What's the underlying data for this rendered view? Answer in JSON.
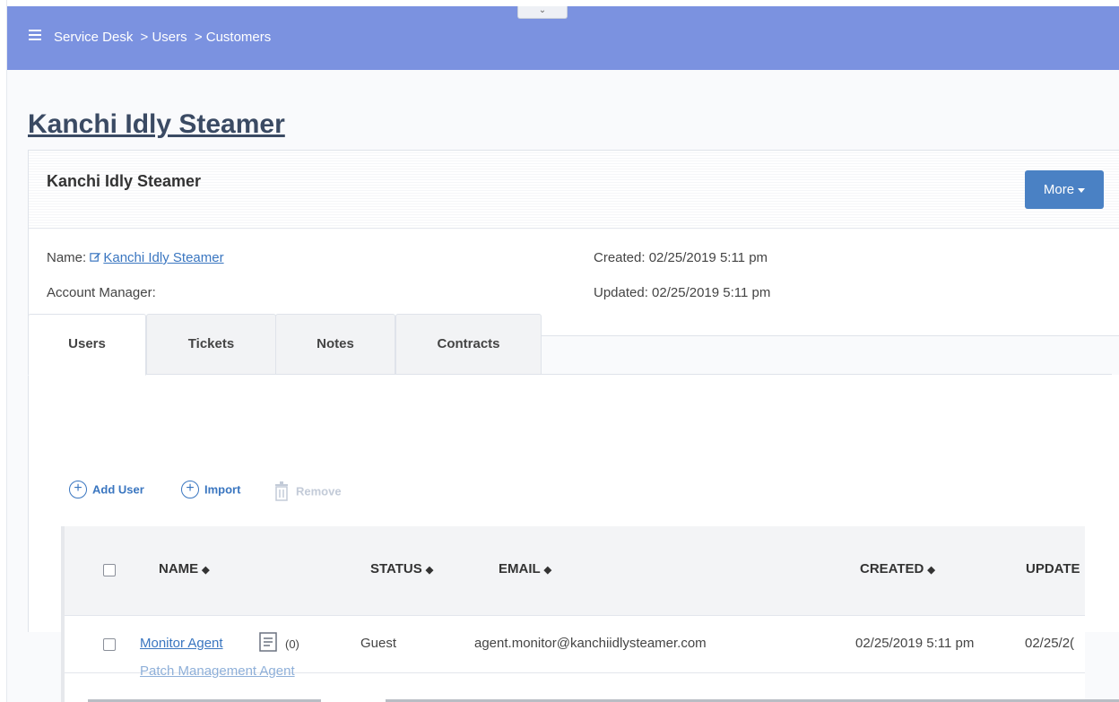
{
  "topbar": {
    "breadcrumb": [
      "Service Desk",
      "> Users",
      "> Customers"
    ]
  },
  "page": {
    "title": "Kanchi Idly Steamer"
  },
  "panel": {
    "title": "Kanchi Idly Steamer",
    "more_label": "More",
    "name_label": "Name:",
    "name_value": "Kanchi Idly Steamer",
    "account_manager_label": "Account Manager:",
    "created": "Created: 02/25/2019 5:11 pm",
    "updated": "Updated: 02/25/2019 5:11 pm"
  },
  "tabs": [
    "Users",
    "Tickets",
    "Notes",
    "Contracts"
  ],
  "toolbar": {
    "add_user": "Add User",
    "import": "Import",
    "remove": "Remove"
  },
  "table": {
    "columns": [
      "NAME",
      "STATUS",
      "EMAIL",
      "CREATED",
      "UPDATE"
    ],
    "rows": [
      {
        "name": "Monitor Agent",
        "notes_count": "(0)",
        "status": "Guest",
        "email": "agent.monitor@kanchiidlysteamer.com",
        "created": "02/25/2019 5:11 pm",
        "updated": "02/25/2("
      },
      {
        "name": "Patch Management Agent"
      }
    ]
  },
  "colors": {
    "topbar": "#7b92e0",
    "link": "#3a76c0",
    "button": "#4a81c4"
  }
}
